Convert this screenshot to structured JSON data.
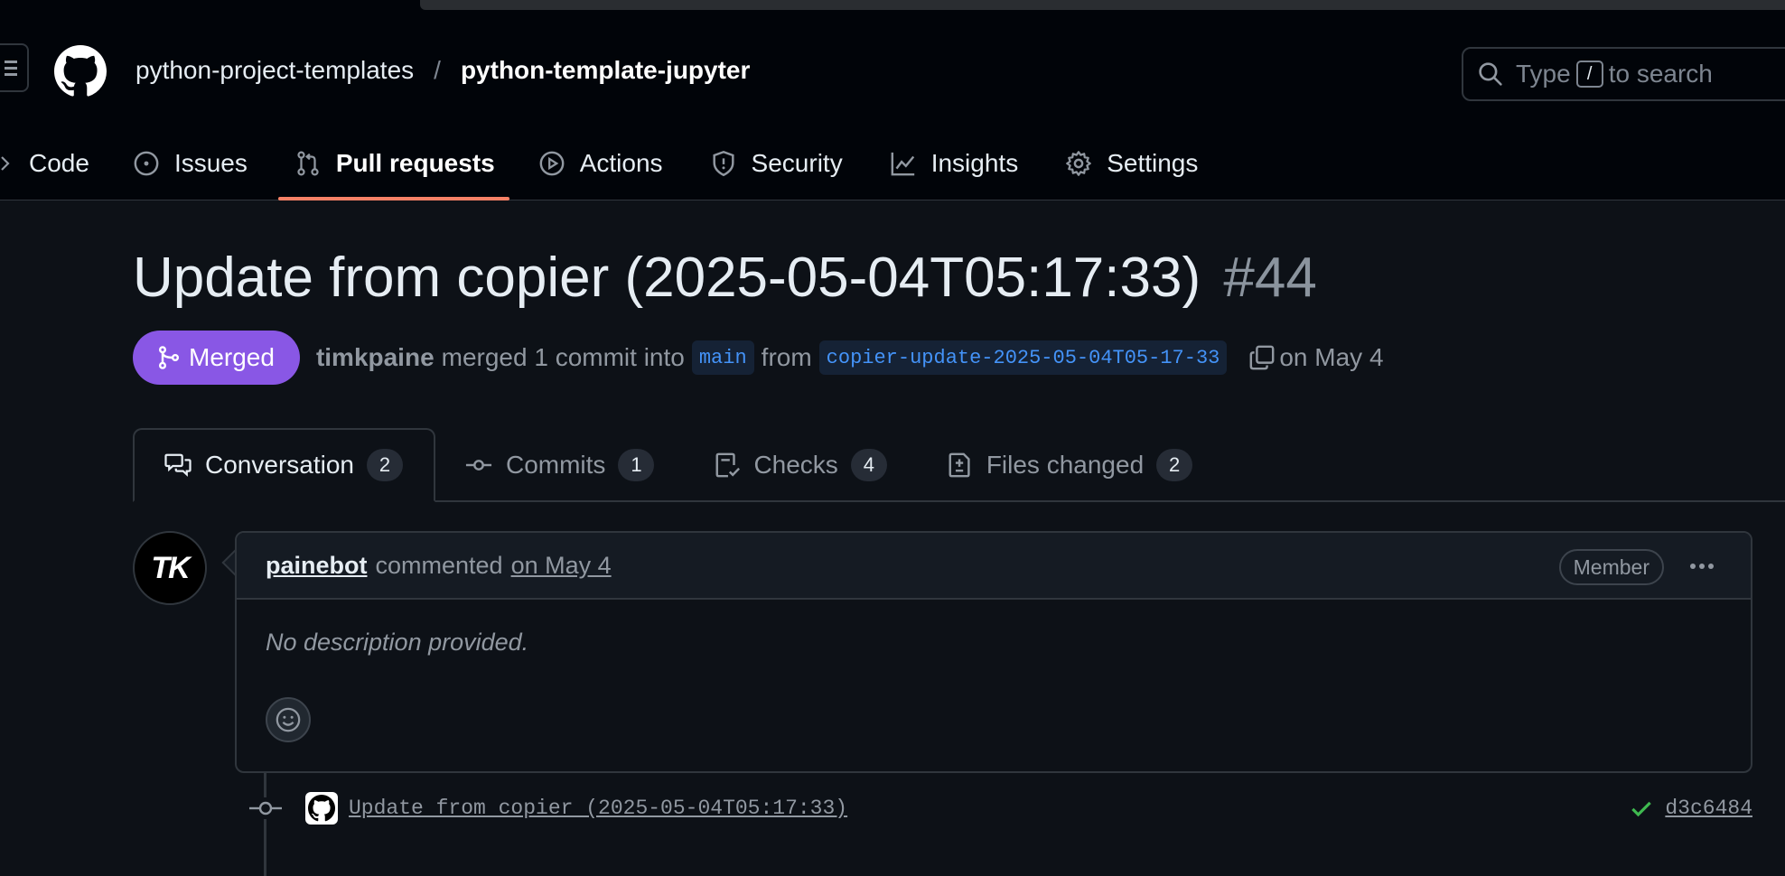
{
  "header": {
    "owner": "python-project-templates",
    "separator": "/",
    "repo": "python-template-jupyter",
    "search": {
      "prefix": "Type",
      "key": "/",
      "suffix": "to search"
    }
  },
  "repo_nav": [
    {
      "label": "Code",
      "icon": "chevron-right-icon"
    },
    {
      "label": "Issues",
      "icon": "issue-opened-icon"
    },
    {
      "label": "Pull requests",
      "icon": "git-pull-request-icon",
      "active": true
    },
    {
      "label": "Actions",
      "icon": "play-icon"
    },
    {
      "label": "Security",
      "icon": "shield-icon"
    },
    {
      "label": "Insights",
      "icon": "graph-icon"
    },
    {
      "label": "Settings",
      "icon": "gear-icon"
    }
  ],
  "pr": {
    "title": "Update from copier (2025-05-04T05:17:33)",
    "number": "#44",
    "state": "Merged",
    "author": "timkpaine",
    "action_text": "merged 1 commit into",
    "base_branch": "main",
    "from_text": "from",
    "head_branch": "copier-update-2025-05-04T05-17-33",
    "date_text": "on May 4"
  },
  "tabs": [
    {
      "label": "Conversation",
      "count": "2",
      "icon": "comment-discussion-icon",
      "active": true
    },
    {
      "label": "Commits",
      "count": "1",
      "icon": "git-commit-icon"
    },
    {
      "label": "Checks",
      "count": "4",
      "icon": "checklist-icon"
    },
    {
      "label": "Files changed",
      "count": "2",
      "icon": "file-diff-icon"
    }
  ],
  "comment": {
    "avatar_text": "TK",
    "author": "painebot",
    "verb": "commented",
    "when": "on May 4",
    "role": "Member",
    "body": "No description provided."
  },
  "commit": {
    "message": "Update from copier (2025-05-04T05:17:33)",
    "sha": "d3c6484",
    "status": "success"
  },
  "colors": {
    "background": "#0d1117",
    "header_bg": "#010409",
    "merged": "#8957e5",
    "accent_underline": "#f78166",
    "link_blue": "#4493f8",
    "success": "#3fb950"
  }
}
